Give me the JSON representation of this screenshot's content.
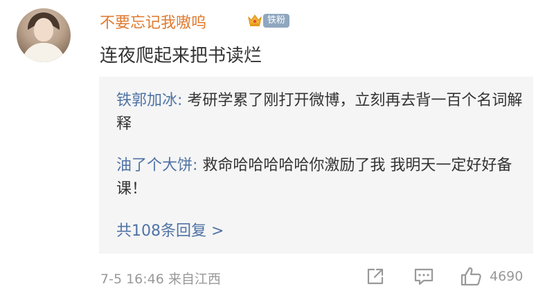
{
  "post": {
    "username": "不要忘记我嗷呜",
    "fan_badge": "铁粉",
    "text": "连夜爬起来把书读烂",
    "timestamp": "7-5 16:46",
    "source": "来自江西",
    "like_count": "4690"
  },
  "replies": [
    {
      "name": "铁郭加冰:",
      "text": " 考研学累了刚打开微博，立刻再去背一百个名词解释"
    },
    {
      "name": "油了个大饼:",
      "text": " 救命哈哈哈哈哈你激励了我 我明天一定好好备课！"
    }
  ],
  "more_replies": "共108条回复 >",
  "colors": {
    "username": "#e07a2f",
    "reply_name": "#4f73a5",
    "badge": "#8fa7bf",
    "meta": "#999999"
  },
  "icons": [
    "crown-icon",
    "share-icon",
    "comment-icon",
    "like-icon"
  ]
}
